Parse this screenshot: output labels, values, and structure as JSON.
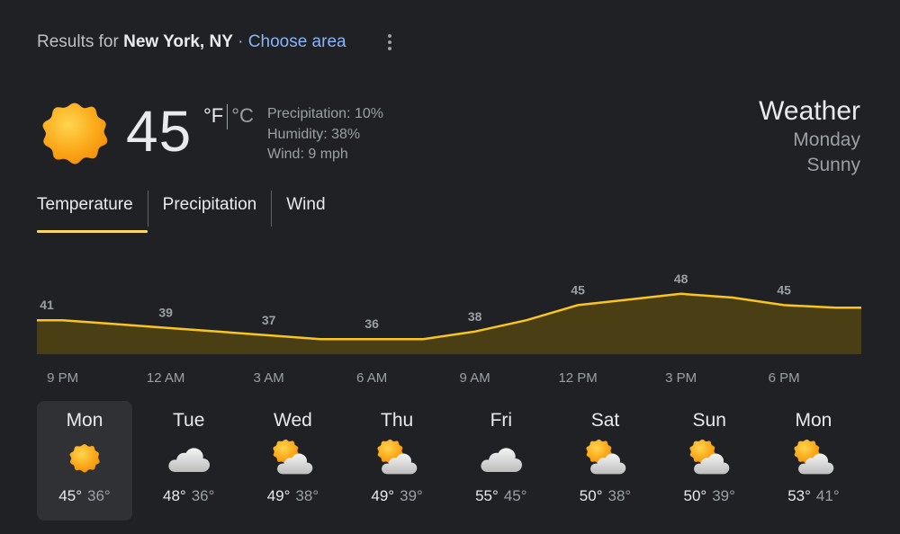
{
  "header": {
    "results_prefix": "Results for",
    "location": "New York, NY",
    "separator": "·",
    "choose_area": "Choose area"
  },
  "current": {
    "icon": "sun-icon",
    "temperature": "45",
    "unit_f": "°F",
    "unit_c": "°C",
    "precipitation": "Precipitation: 10%",
    "humidity": "Humidity: 38%",
    "wind": "Wind: 9 mph"
  },
  "summary": {
    "title": "Weather",
    "day": "Monday",
    "condition": "Sunny"
  },
  "tabs": [
    {
      "label": "Temperature",
      "active": true
    },
    {
      "label": "Precipitation",
      "active": false
    },
    {
      "label": "Wind",
      "active": false
    }
  ],
  "colors": {
    "background": "#202124",
    "accent": "#fdd663",
    "line": "#f9c51e",
    "area_fill": "#4a3f14",
    "link": "#8ab4f8"
  },
  "chart_data": {
    "type": "area",
    "x": [
      "9 PM",
      "",
      "12 AM",
      "",
      "3 AM",
      "",
      "6 AM",
      "",
      "9 AM",
      "",
      "12 PM",
      "",
      "3 PM",
      "",
      "6 PM",
      ""
    ],
    "hour_labels": [
      "9 PM",
      "12 AM",
      "3 AM",
      "6 AM",
      "9 AM",
      "12 PM",
      "3 PM",
      "6 PM"
    ],
    "values": [
      41,
      40,
      39,
      38,
      37,
      36,
      36,
      36,
      38,
      41,
      45,
      46.5,
      48,
      47,
      45,
      44.3
    ],
    "point_labels": [
      41,
      39,
      37,
      36,
      38,
      45,
      48,
      45
    ],
    "ylim": [
      32,
      52
    ],
    "grid": false
  },
  "days": [
    {
      "name": "Mon",
      "icon": "sun-icon",
      "hi": "45°",
      "lo": "36°",
      "selected": true
    },
    {
      "name": "Tue",
      "icon": "cloud-icon",
      "hi": "48°",
      "lo": "36°",
      "selected": false
    },
    {
      "name": "Wed",
      "icon": "partly-cloudy-icon",
      "hi": "49°",
      "lo": "38°",
      "selected": false
    },
    {
      "name": "Thu",
      "icon": "partly-cloudy-icon",
      "hi": "49°",
      "lo": "39°",
      "selected": false
    },
    {
      "name": "Fri",
      "icon": "cloud-icon",
      "hi": "55°",
      "lo": "45°",
      "selected": false
    },
    {
      "name": "Sat",
      "icon": "partly-cloudy-icon",
      "hi": "50°",
      "lo": "38°",
      "selected": false
    },
    {
      "name": "Sun",
      "icon": "partly-cloudy-icon",
      "hi": "50°",
      "lo": "39°",
      "selected": false
    },
    {
      "name": "Mon",
      "icon": "partly-cloudy-icon",
      "hi": "53°",
      "lo": "41°",
      "selected": false
    }
  ]
}
